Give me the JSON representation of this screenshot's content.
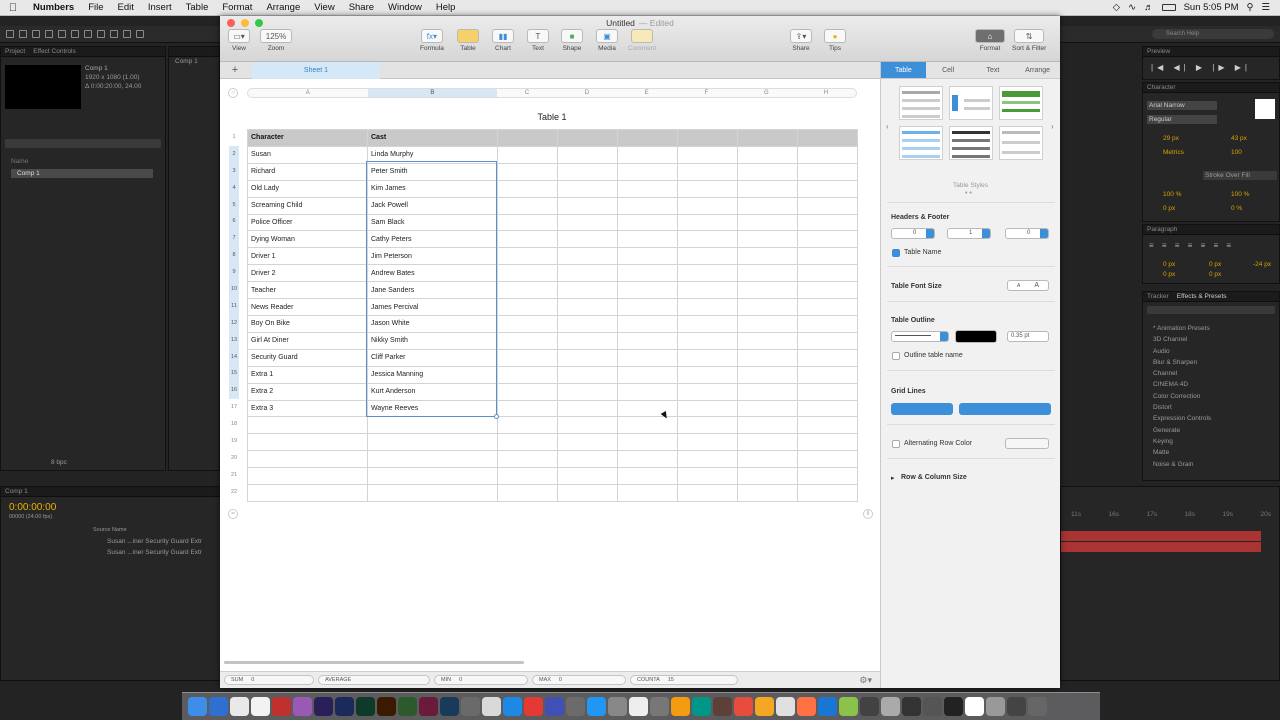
{
  "menubar": {
    "app": "Numbers",
    "items": [
      "File",
      "Edit",
      "Insert",
      "Table",
      "Format",
      "Arrange",
      "View",
      "Share",
      "Window",
      "Help"
    ],
    "clock": "Sun 5:05 PM"
  },
  "ae_left": {
    "panel1_tabs": [
      "Project",
      "Effect Controls"
    ],
    "comp_name": "Comp 1",
    "comp_info1": "1920 x 1080 (1.00)",
    "comp_info2": "Δ 0:00:20:00, 24.00",
    "item": "Comp 1",
    "bpc": "8 bpc",
    "timecode": "0:00:00:00",
    "fps": "00000 (24.00 fps)",
    "layer_hdr": "Source Name",
    "layers": [
      "Susan ...iner Security Guard Extr",
      "Susan ...iner Security Guard Extr"
    ],
    "comp_tab": "Comp 1"
  },
  "ae_right": {
    "search": "Search Help",
    "preview": "Preview",
    "character": "Character",
    "font": "Arial Narrow",
    "style": "Regular",
    "size": "29 px",
    "leading": "43 px",
    "kern": "Metrics",
    "track": "100",
    "stroke": "Stroke Over Fill",
    "vscale": "100 %",
    "hscale": "100 %",
    "baseline": "0 px",
    "tsume": "0 %",
    "paragraph": "Paragraph",
    "para_vals": [
      "0 px",
      "0 px",
      "-24 px",
      "0 px",
      "0 px"
    ],
    "tracker": "Tracker",
    "effects": "Effects & Presets",
    "effects_list": [
      "* Animation Presets",
      "3D Channel",
      "Audio",
      "Blur & Sharpen",
      "Channel",
      "CINEMA 4D",
      "Color Correction",
      "Distort",
      "Expression Controls",
      "Generate",
      "Keying",
      "Matte",
      "Noise & Grain"
    ],
    "timeline_marks": [
      "11s",
      "16s",
      "17s",
      "18s",
      "19s",
      "20s"
    ]
  },
  "window": {
    "title": "Untitled",
    "edited": "— Edited",
    "toolbar": {
      "view": "View",
      "zoom_value": "125%",
      "zoom": "Zoom",
      "formula": "Formula",
      "table": "Table",
      "chart": "Chart",
      "text": "Text",
      "shape": "Shape",
      "media": "Media",
      "comment": "Comment",
      "share": "Share",
      "tips": "Tips",
      "format": "Format",
      "sort_filter": "Sort & Filter"
    },
    "sheet_tab": "Sheet 1",
    "add_sheet": "+"
  },
  "table": {
    "title": "Table 1",
    "columns": [
      "A",
      "B",
      "C",
      "D",
      "E",
      "F",
      "G",
      "H"
    ],
    "header": [
      "Character",
      "Cast"
    ],
    "rows": [
      [
        "Susan",
        "Linda Murphy"
      ],
      [
        "Richard",
        "Peter Smith"
      ],
      [
        "Old Lady",
        "Kim James"
      ],
      [
        "Screaming Child",
        "Jack Powell"
      ],
      [
        "Police Officer",
        "Sam Black"
      ],
      [
        "Dying Woman",
        "Cathy Peters"
      ],
      [
        "Driver 1",
        "Jim Peterson"
      ],
      [
        "Driver 2",
        "Andrew Bates"
      ],
      [
        "Teacher",
        "Jane Sanders"
      ],
      [
        "News Reader",
        "James Percival"
      ],
      [
        "Boy On Bike",
        "Jason White"
      ],
      [
        "Girl At Diner",
        "Nikky Smith"
      ],
      [
        "Security Guard",
        "Cliff Parker"
      ],
      [
        "Extra 1",
        "Jessica Manning"
      ],
      [
        "Extra 2",
        "Kurt Anderson"
      ],
      [
        "Extra 3",
        "Wayne Reeves"
      ],
      [
        "",
        ""
      ],
      [
        "",
        ""
      ],
      [
        "",
        ""
      ],
      [
        "",
        ""
      ],
      [
        "",
        ""
      ]
    ],
    "row_numbers": [
      "1",
      "2",
      "3",
      "4",
      "5",
      "6",
      "7",
      "8",
      "9",
      "10",
      "11",
      "12",
      "13",
      "14",
      "15",
      "16",
      "17",
      "18",
      "19",
      "20",
      "21",
      "22"
    ]
  },
  "statusbar": {
    "sum_label": "SUM",
    "sum_val": "0",
    "avg_label": "AVERAGE",
    "avg_val": "",
    "min_label": "MIN",
    "min_val": "0",
    "max_label": "MAX",
    "max_val": "0",
    "counta_label": "COUNTA",
    "counta_val": "15"
  },
  "inspector": {
    "tabs": [
      "Table",
      "Cell",
      "Text",
      "Arrange"
    ],
    "table_styles": "Table Styles",
    "headers_footer": "Headers & Footer",
    "hf_values": [
      "0",
      "1",
      "0"
    ],
    "table_name": "Table Name",
    "table_font_size": "Table Font Size",
    "font_small": "A",
    "font_big": "A",
    "table_outline": "Table Outline",
    "outline_width": "0.35 pt",
    "outline_table_name": "Outline table name",
    "grid_lines": "Grid Lines",
    "alt_row_color": "Alternating Row Color",
    "row_col_size": "Row & Column Size"
  },
  "colors": {
    "accent": "#3e8fd9",
    "selection": "#5b8fd0",
    "header_fill": "#c9c9c9"
  }
}
